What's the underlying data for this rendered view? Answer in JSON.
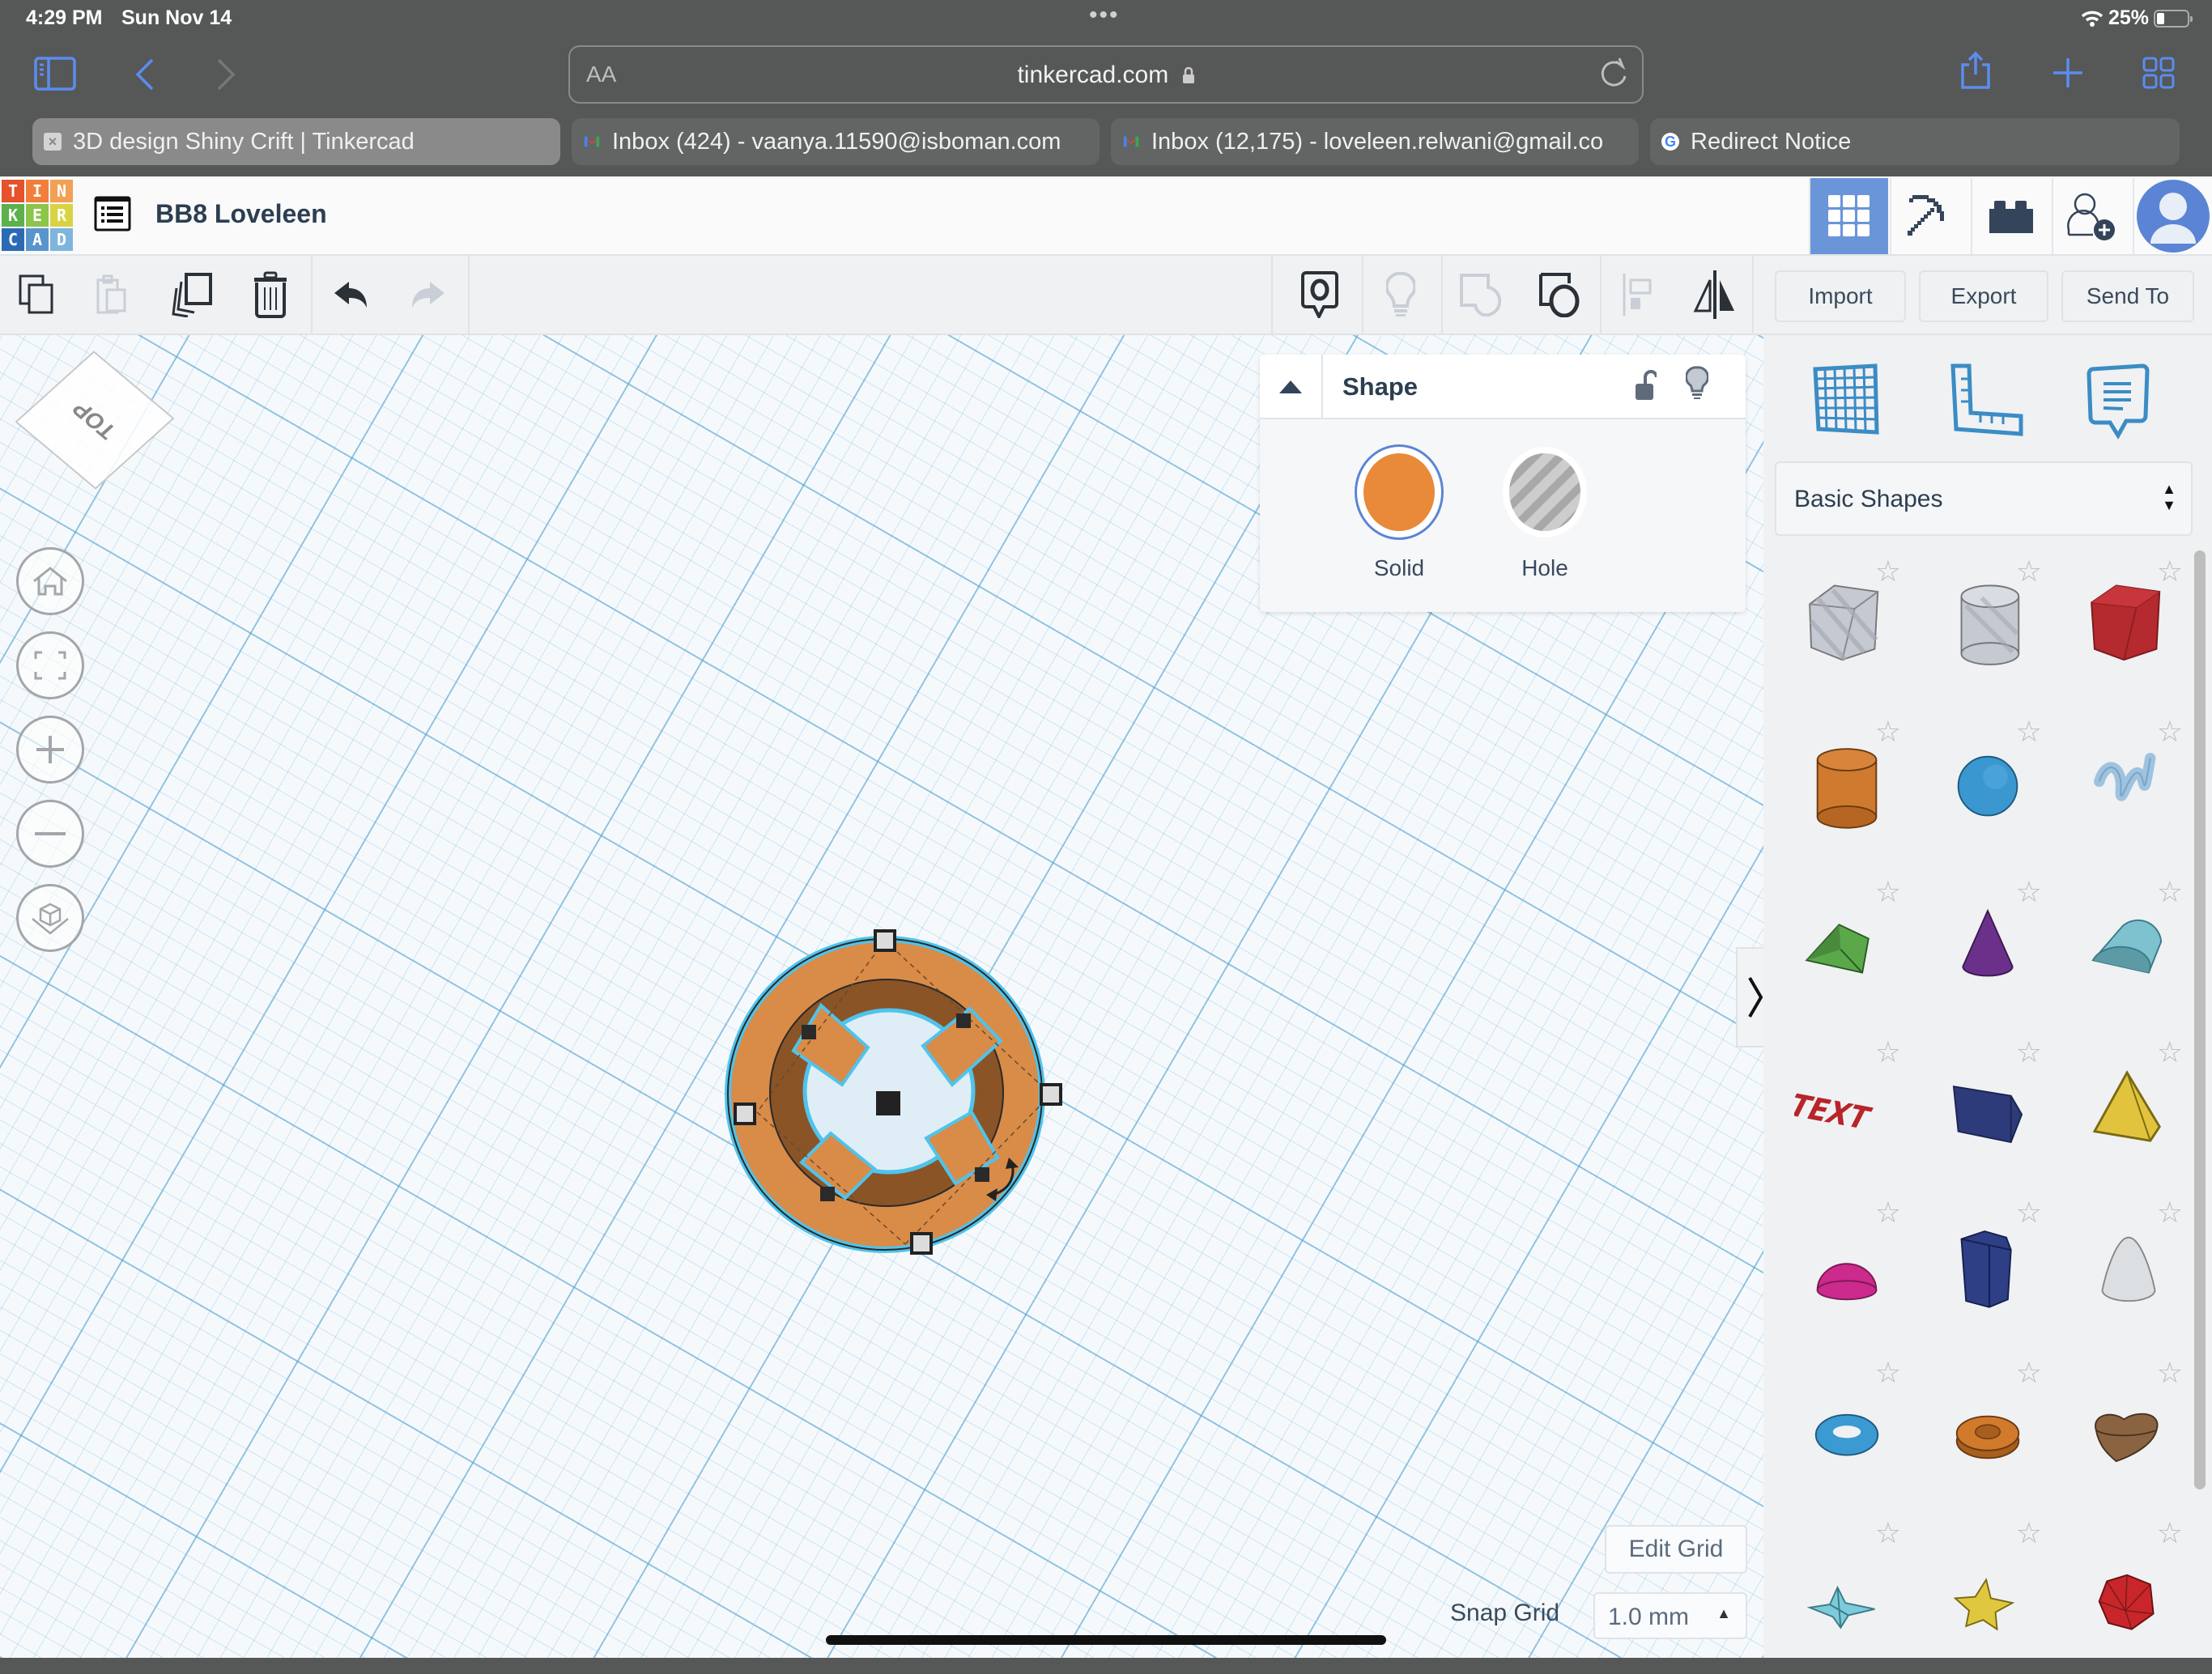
{
  "status_bar": {
    "time": "4:29 PM",
    "date": "Sun Nov 14",
    "dots": "•••",
    "battery_percent": "25%"
  },
  "safari": {
    "url_aa": "AA",
    "url": "tinkercad.com",
    "tabs": [
      {
        "title": "3D design Shiny Crift | Tinkercad",
        "favicon": "close-tab",
        "active": true
      },
      {
        "title": "Inbox (424) - vaanya.11590@isboman.com",
        "favicon": "gmail",
        "active": false
      },
      {
        "title": "Inbox (12,175) - loveleen.relwani@gmail.co",
        "favicon": "gmail",
        "active": false
      },
      {
        "title": "Redirect Notice",
        "favicon": "google",
        "active": false
      }
    ]
  },
  "header": {
    "logo_letters": [
      "T",
      "I",
      "N",
      "K",
      "E",
      "R",
      "C",
      "A",
      "D"
    ],
    "logo_colors": [
      "#e5522c",
      "#f07f3c",
      "#f2a055",
      "#5cb14d",
      "#8cc54a",
      "#d9d344",
      "#2b6bb5",
      "#5a94cc",
      "#7fb5dd"
    ],
    "design_title": "BB8 Loveleen",
    "nav": [
      {
        "name": "3d-design-view",
        "active": true
      },
      {
        "name": "minecraft-view",
        "active": false
      },
      {
        "name": "lego-bricks-view",
        "active": false
      },
      {
        "name": "invite-user",
        "active": false
      },
      {
        "name": "profile-avatar",
        "active": false
      }
    ]
  },
  "toolbar": {
    "import_label": "Import",
    "export_label": "Export",
    "send_to_label": "Send To"
  },
  "workplane": {
    "view_cube_label": "TOP",
    "edit_grid_label": "Edit Grid",
    "snap_grid_label": "Snap Grid",
    "snap_grid_value": "1.0 mm"
  },
  "inspector": {
    "title": "Shape",
    "solid_label": "Solid",
    "hole_label": "Hole",
    "solid_color": "#e88a3a",
    "selected": "solid"
  },
  "right_panel": {
    "category_selected": "Basic Shapes",
    "shapes": [
      {
        "name": "Box (hole)",
        "color": "#c4c9d2"
      },
      {
        "name": "Cylinder (hole)",
        "color": "#c4c9d2"
      },
      {
        "name": "Box",
        "color": "#b52a2e"
      },
      {
        "name": "Cylinder",
        "color": "#cf7a2e"
      },
      {
        "name": "Sphere",
        "color": "#3a97d0"
      },
      {
        "name": "Scribble",
        "color": "#9ec3e0"
      },
      {
        "name": "Roof",
        "color": "#5aa84a"
      },
      {
        "name": "Cone",
        "color": "#6b318a"
      },
      {
        "name": "Round Roof",
        "color": "#7ec1cf"
      },
      {
        "name": "Text",
        "color": "#b82429"
      },
      {
        "name": "Wedge",
        "color": "#2d3b7a"
      },
      {
        "name": "Pyramid",
        "color": "#e2c33e"
      },
      {
        "name": "Half Sphere",
        "color": "#cc2a8c"
      },
      {
        "name": "Polygon",
        "color": "#2f3f85"
      },
      {
        "name": "Paraboloid",
        "color": "#dcdfe2"
      },
      {
        "name": "Torus",
        "color": "#3b9ad2"
      },
      {
        "name": "Tube",
        "color": "#d27a2c"
      },
      {
        "name": "Heart",
        "color": "#8a6440"
      },
      {
        "name": "Star",
        "color": "#7ccbdb"
      },
      {
        "name": "Star (extruded)",
        "color": "#dfc840"
      },
      {
        "name": "Icosahedron",
        "color": "#c8262a"
      }
    ]
  },
  "colors": {
    "accent_blue": "#6a95d8",
    "selection_outline": "#4fc3ec",
    "object_orange": "#d98b48"
  }
}
